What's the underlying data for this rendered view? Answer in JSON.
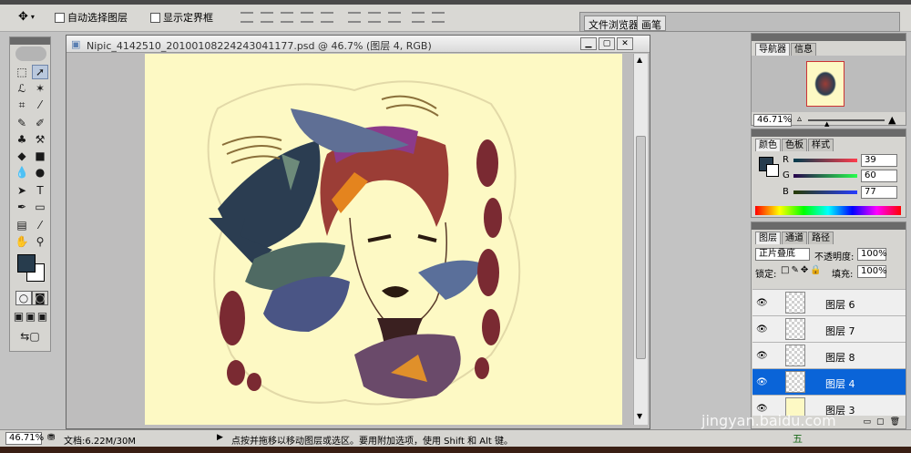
{
  "options_bar": {
    "auto_select_label": "自动选择图层",
    "show_bounds_label": "显示定界框",
    "panel_well_tabs": [
      "文件浏览器",
      "画笔"
    ]
  },
  "document": {
    "title": "Nipic_4142510_20100108224243041177.psd @ 46.7% (图层 4, RGB)"
  },
  "navigator": {
    "tabs": [
      "导航器",
      "信息"
    ],
    "zoom": "46.71%"
  },
  "color": {
    "tabs": [
      "颜色",
      "色板",
      "样式"
    ],
    "labels": [
      "R",
      "G",
      "B"
    ],
    "values": [
      "39",
      "60",
      "77"
    ],
    "foreground": "#273c4d"
  },
  "layers": {
    "tabs": [
      "图层",
      "通道",
      "路径"
    ],
    "blend_mode": "正片叠底",
    "opacity_label": "不透明度:",
    "opacity_value": "100%",
    "lock_label": "锁定:",
    "fill_label": "填充:",
    "fill_value": "100%",
    "rows": [
      {
        "name": "图层 6"
      },
      {
        "name": "图层 7"
      },
      {
        "name": "图层 8"
      },
      {
        "name": "图层 4",
        "selected": true
      },
      {
        "name": "图层 3"
      }
    ]
  },
  "status": {
    "zoom": "46.71%",
    "doc_size": "文档:6.22M/30M",
    "hint": "点按并拖移以移动图层或选区。要用附加选项，使用 Shift 和 Alt 键。"
  },
  "watermark": "jingyan.baidu.com",
  "ime": "五"
}
